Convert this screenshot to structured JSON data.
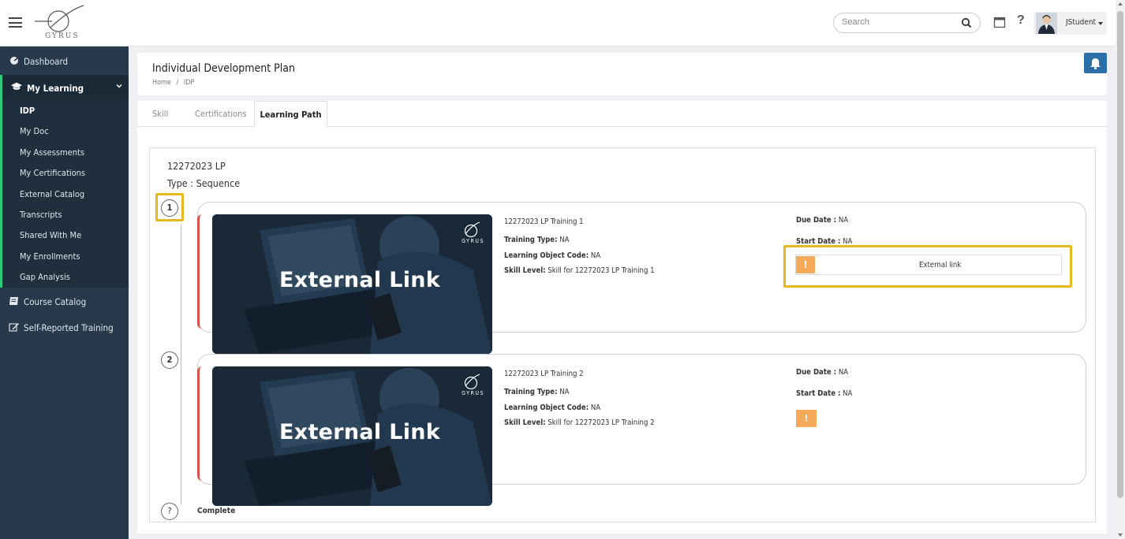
{
  "header": {
    "logo_text": "GYRUS",
    "search_placeholder": "Search",
    "user_name": "JStudent"
  },
  "sidebar": {
    "dashboard": "Dashboard",
    "my_learning": "My Learning",
    "sub_items": [
      "IDP",
      "My Doc",
      "My Assessments",
      "My Certifications",
      "External Catalog",
      "Transcripts",
      "Shared With Me",
      "My Enrollments",
      "Gap Analysis"
    ],
    "course_catalog": "Course Catalog",
    "self_reported": "Self-Reported Training"
  },
  "page": {
    "title": "Individual Development Plan",
    "breadcrumb_home": "Home",
    "breadcrumb_sep": "/",
    "breadcrumb_current": "IDP"
  },
  "tabs": [
    "Skill",
    "Certifications",
    "Learning Path"
  ],
  "learning_path": {
    "title": "12272023 LP",
    "type": "Type : Sequence",
    "complete_marker": "?",
    "complete_label": "Complete",
    "thumbnail_title": "External Link",
    "thumbnail_brand": "GYRUS",
    "trainings": [
      {
        "step": "1",
        "name": "12272023 LP Training 1",
        "training_type_label": "Training Type:",
        "training_type": "NA",
        "object_code_label": "Learning Object Code:",
        "object_code": "NA",
        "skill_level_label": "Skill Level:",
        "skill_level": "Skill for 12272023 LP Training 1",
        "due_date_label": "Due Date :",
        "due_date": "NA",
        "start_date_label": "Start Date :",
        "start_date": "NA",
        "warn_icon": "!",
        "action_label": "External link"
      },
      {
        "step": "2",
        "name": "12272023 LP Training 2",
        "training_type_label": "Training Type:",
        "training_type": "NA",
        "object_code_label": "Learning Object Code:",
        "object_code": "NA",
        "skill_level_label": "Skill Level:",
        "skill_level": "Skill for 12272023 LP Training 2",
        "due_date_label": "Due Date :",
        "due_date": "NA",
        "start_date_label": "Start Date :",
        "start_date": "NA",
        "warn_icon": "!"
      }
    ]
  },
  "colors": {
    "sidebar_bg": "#273a4b",
    "accent_green": "#2ec97b",
    "highlight": "#e8b821",
    "warn_orange": "#f5a95a",
    "card_red": "#d9534f",
    "bell_blue": "#2a6fa8"
  }
}
